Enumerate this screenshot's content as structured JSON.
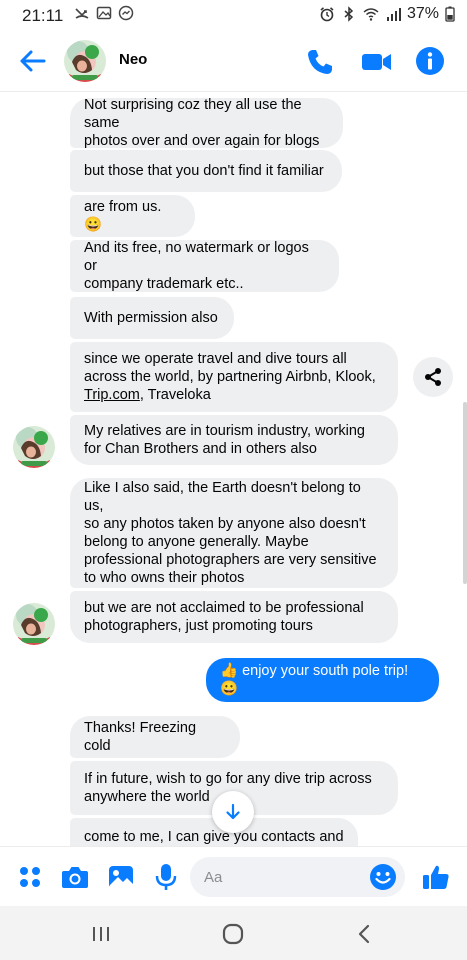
{
  "status_bar": {
    "time": "21:11",
    "battery": "37%"
  },
  "header": {
    "contact_name": "Neo",
    "accent_color": "#0a7cff"
  },
  "messages": [
    {
      "side": "received",
      "text": "Not surprising coz they all use the same\nphotos over and over again for blogs"
    },
    {
      "side": "received",
      "text": "but those that you don't find it familiar"
    },
    {
      "side": "received",
      "text": "are from us. 😀"
    },
    {
      "side": "received",
      "text": "And its free, no watermark or logos or\ncompany trademark etc.."
    },
    {
      "side": "received",
      "text": "With permission also"
    },
    {
      "side": "received",
      "text_before": "since we operate travel and dive tours all\nacross the world, by partnering Airbnb, Klook,\n",
      "link": "Trip.com",
      "text_after": ", Traveloka"
    },
    {
      "side": "received",
      "text": "My relatives are in tourism industry, working\nfor Chan Brothers and in others also"
    },
    {
      "side": "received",
      "text": "Like I also said, the Earth doesn't belong to us,\nso any photos taken by anyone also doesn't\nbelong to anyone generally. Maybe\nprofessional photographers are very sensitive\nto who owns their photos"
    },
    {
      "side": "received",
      "text": "but we are not acclaimed to be professional\nphotographers, just promoting tours"
    },
    {
      "side": "sent",
      "text": "👍 enjoy your south pole trip! 😀"
    },
    {
      "side": "received",
      "text": "Thanks! Freezing cold"
    },
    {
      "side": "received",
      "text": "If in future, wish to go for any dive trip across\nanywhere the world"
    },
    {
      "side": "received",
      "text": "come to me, I can give you contacts and"
    }
  ],
  "composer": {
    "placeholder": "Aa"
  }
}
